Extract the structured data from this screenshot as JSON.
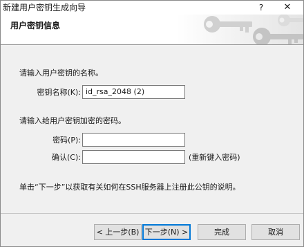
{
  "window": {
    "title": "新建用户密钥生成向导",
    "help_label": "?",
    "close_label": "✕"
  },
  "header": {
    "title": "用户密钥信息",
    "icon": "keys-icon"
  },
  "form": {
    "name_prompt": "请输入用户密钥的名称。",
    "key_name_label": "密钥名称(K):",
    "key_name_value": "id_rsa_2048 (2)",
    "password_prompt": "请输入给用户密钥加密的密码。",
    "password_label": "密码(P):",
    "password_value": "",
    "confirm_label": "确认(C):",
    "confirm_value": "",
    "confirm_hint": "(重新键入密码)",
    "instruction": "单击“下一步”以获取有关如何在SSH服务器上注册此公钥的说明。"
  },
  "buttons": {
    "back": "< 上一步(B)",
    "next": "下一步(N) >",
    "finish": "完成",
    "cancel": "取消"
  }
}
